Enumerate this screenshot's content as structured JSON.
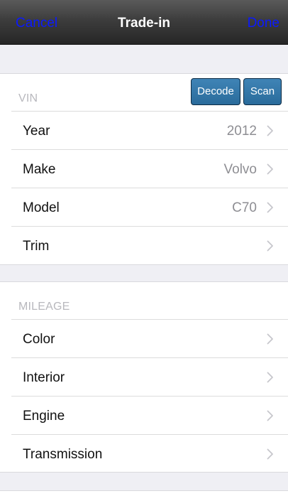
{
  "navbar": {
    "cancel_label": "Cancel",
    "title": "Trade-in",
    "done_label": "Done",
    "button_color": "#0b19ff"
  },
  "vehicle_section": {
    "header": "VIN",
    "decode_label": "Decode",
    "scan_label": "Scan",
    "rows": [
      {
        "label": "Year",
        "value": "2012"
      },
      {
        "label": "Make",
        "value": "Volvo"
      },
      {
        "label": "Model",
        "value": "C70"
      },
      {
        "label": "Trim",
        "value": ""
      }
    ]
  },
  "details_section": {
    "header": "MILEAGE",
    "rows": [
      {
        "label": "Color",
        "value": ""
      },
      {
        "label": "Interior",
        "value": ""
      },
      {
        "label": "Engine",
        "value": ""
      },
      {
        "label": "Transmission",
        "value": ""
      }
    ]
  },
  "icons": {
    "row_disclosure": "chevron-right-icon"
  }
}
